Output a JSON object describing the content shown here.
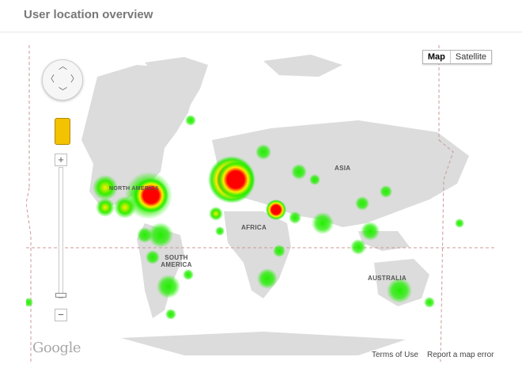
{
  "panel": {
    "title": "User location overview"
  },
  "map": {
    "map_type": {
      "map_label": "Map",
      "satellite_label": "Satellite",
      "selected": "Map"
    },
    "region_labels": [
      "NORTH AMERICA",
      "ASIA",
      "AFRICA",
      "SOUTH AMERICA",
      "AUSTRALIA"
    ],
    "logo": "Google",
    "terms_label": "Terms of Use",
    "report_label": "Report a map error",
    "zoom": {
      "in_label": "+",
      "out_label": "−",
      "level": 0.04
    },
    "colors": {
      "land": "#dcdcdc",
      "water": "#ffffff",
      "hot": "#ff0000",
      "warm": "#ffff00",
      "cool": "#00e600"
    }
  }
}
